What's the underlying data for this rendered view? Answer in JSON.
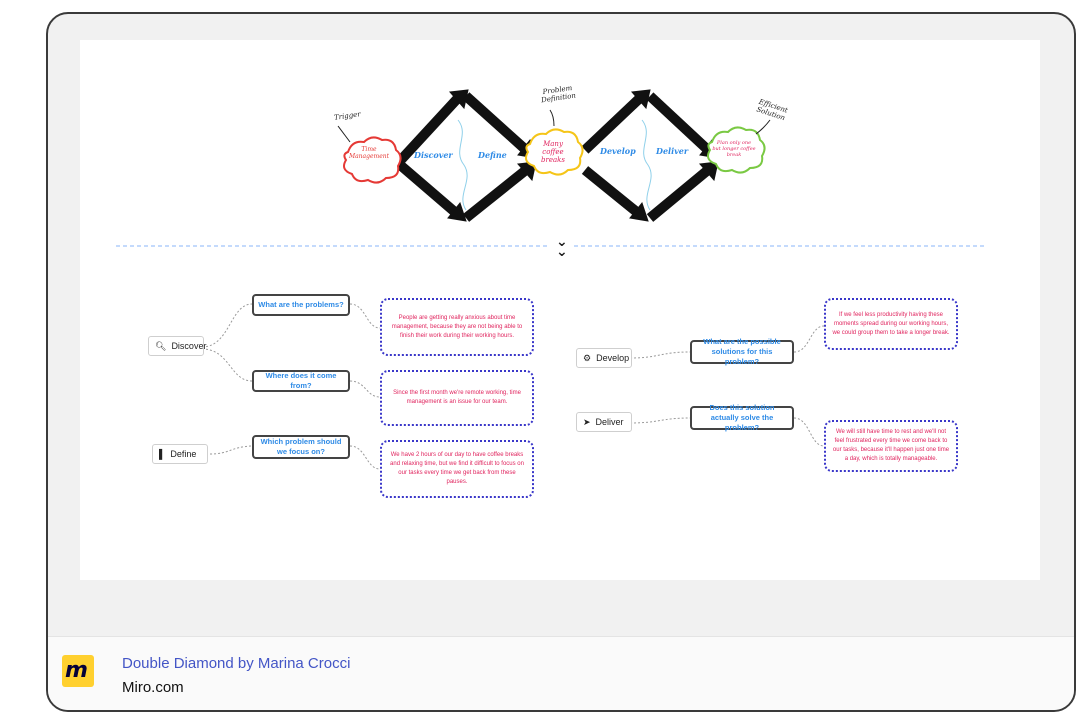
{
  "board": {
    "diagram": {
      "trigger": "Trigger",
      "problem_definition": "Problem Definition",
      "efficient_solution": "Efficient Solution",
      "cloud_left": "Time Management",
      "cloud_mid": "Many coffee breaks",
      "cloud_right": "Plan only one but longer coffee break",
      "discover": "Discover",
      "define": "Define",
      "develop": "Develop",
      "deliver": "Deliver",
      "colors": {
        "cloud_left": "#e53935",
        "cloud_mid": "#f5c518",
        "cloud_right": "#7ac943",
        "phase_text": "#2f8be6",
        "arrow": "#111111"
      }
    },
    "divider_icon": "double-chevron-down-icon",
    "mindmap_left": {
      "discover": {
        "label": "Discover",
        "icon": "search-icon"
      },
      "define": {
        "label": "Define",
        "icon": "bookmark-icon"
      },
      "q1": "What are the problems?",
      "q2": "Where does it come from?",
      "q3": "Which problem should we focus on?",
      "a1": "People are getting really anxious about time management, because they are not being able to finish their work during their working hours.",
      "a2": "Since the first month we're remote working, time management is an issue for our team.",
      "a3": "We have 2 hours of our day to have coffee breaks and relaxing time, but we find it difficult to focus on our tasks every time we get back from these pauses."
    },
    "mindmap_right": {
      "develop": {
        "label": "Develop",
        "icon": "gear-icon"
      },
      "deliver": {
        "label": "Deliver",
        "icon": "send-icon"
      },
      "q1": "What are the possible solutions for this problem?",
      "q2": "Does this solution actually solve the problem?",
      "a1": "If we feel less productivity having these moments spread during our working hours, we could group them to take a longer break.",
      "a2": "We will still have time to rest and we'll not feel frustrated every time we come back to our tasks, because it'll happen just one time a day, which is totally manageable."
    }
  },
  "footer": {
    "title": "Double Diamond by Marina Crocci",
    "site": "Miro.com",
    "logo_text": "m"
  }
}
